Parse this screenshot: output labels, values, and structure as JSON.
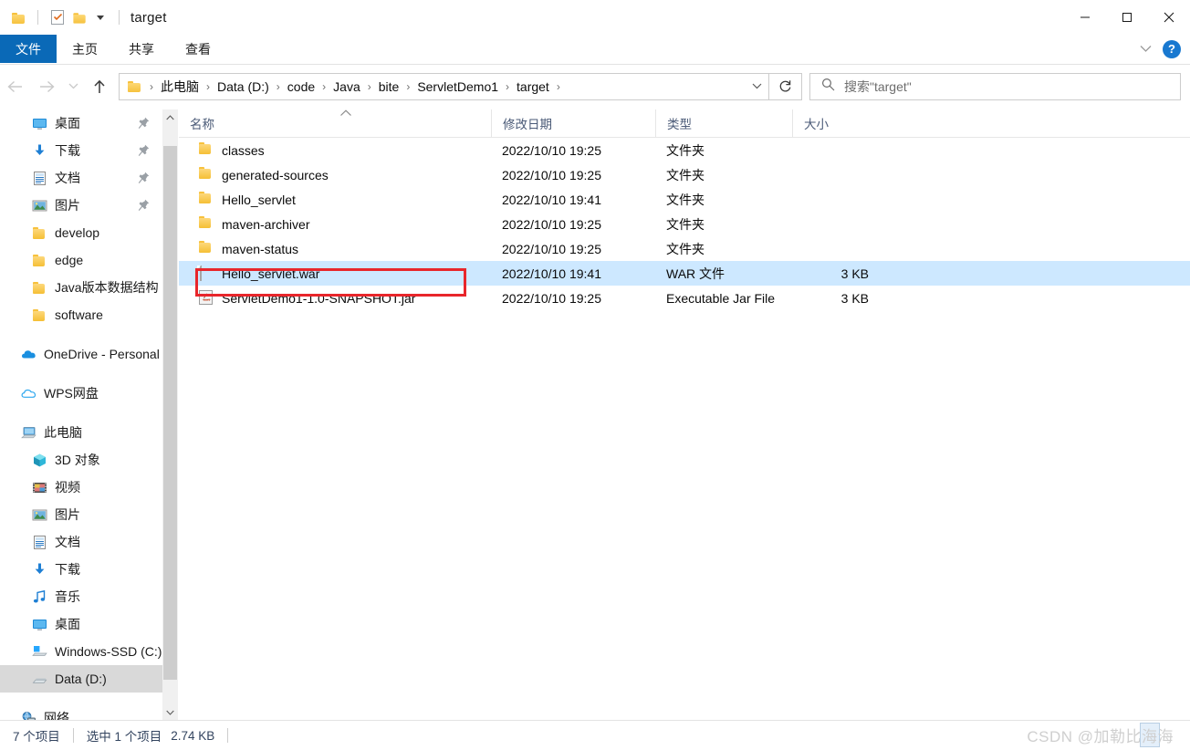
{
  "window": {
    "title": "target",
    "quick_access": [
      {
        "name": "folder-icon",
        "label": "folder"
      },
      {
        "name": "properties-icon",
        "label": "properties"
      },
      {
        "name": "new-folder-icon",
        "label": "new folder"
      },
      {
        "name": "customize-caret-icon",
        "label": "customize quick access toolbar"
      }
    ],
    "controls": {
      "minimize": "minimize",
      "maximize": "maximize",
      "close": "close"
    }
  },
  "ribbon": {
    "tabs": [
      {
        "label": "文件",
        "active": true
      },
      {
        "label": "主页",
        "active": false
      },
      {
        "label": "共享",
        "active": false
      },
      {
        "label": "查看",
        "active": false
      }
    ],
    "collapse_icon": "chevron-down-icon",
    "help_label": "?"
  },
  "nav": {
    "back": "back-arrow-icon",
    "forward": "forward-arrow-icon",
    "recent": "chevron-down-icon",
    "up": "up-arrow-icon",
    "breadcrumbs": [
      "此电脑",
      "Data (D:)",
      "code",
      "Java",
      "bite",
      "ServletDemo1",
      "target"
    ],
    "separator": "›",
    "dropdown_icon": "chevron-down-icon",
    "refresh_icon": "refresh-icon"
  },
  "search": {
    "icon": "search-icon",
    "placeholder": "搜索\"target\""
  },
  "sidebar": {
    "scroll_up_icon": "chevron-up-icon",
    "scroll_down_icon": "chevron-down-icon",
    "groups": [
      {
        "items": [
          {
            "label": "桌面",
            "icon": "desktop-icon",
            "pinned": true,
            "indent": 1
          },
          {
            "label": "下载",
            "icon": "downloads-icon",
            "pinned": true,
            "indent": 1
          },
          {
            "label": "文档",
            "icon": "documents-icon",
            "pinned": true,
            "indent": 1
          },
          {
            "label": "图片",
            "icon": "pictures-icon",
            "pinned": true,
            "indent": 1
          },
          {
            "label": "develop",
            "icon": "folder-icon",
            "pinned": false,
            "indent": 1
          },
          {
            "label": "edge",
            "icon": "folder-icon",
            "pinned": false,
            "indent": 1
          },
          {
            "label": "Java版本数据结构",
            "icon": "folder-icon",
            "pinned": false,
            "indent": 1
          },
          {
            "label": "software",
            "icon": "folder-icon",
            "pinned": false,
            "indent": 1
          }
        ]
      },
      {
        "items": [
          {
            "label": "OneDrive - Personal",
            "icon": "onedrive-icon",
            "pinned": false,
            "indent": 0
          }
        ]
      },
      {
        "items": [
          {
            "label": "WPS网盘",
            "icon": "wps-cloud-icon",
            "pinned": false,
            "indent": 0
          }
        ]
      },
      {
        "items": [
          {
            "label": "此电脑",
            "icon": "this-pc-icon",
            "pinned": false,
            "indent": 0
          },
          {
            "label": "3D 对象",
            "icon": "3d-objects-icon",
            "pinned": false,
            "indent": 1
          },
          {
            "label": "视频",
            "icon": "videos-icon",
            "pinned": false,
            "indent": 1
          },
          {
            "label": "图片",
            "icon": "pictures-icon",
            "pinned": false,
            "indent": 1
          },
          {
            "label": "文档",
            "icon": "documents-icon",
            "pinned": false,
            "indent": 1
          },
          {
            "label": "下载",
            "icon": "downloads-icon",
            "pinned": false,
            "indent": 1
          },
          {
            "label": "音乐",
            "icon": "music-icon",
            "pinned": false,
            "indent": 1
          },
          {
            "label": "桌面",
            "icon": "desktop-icon",
            "pinned": false,
            "indent": 1
          },
          {
            "label": "Windows-SSD (C:)",
            "icon": "windows-drive-icon",
            "pinned": false,
            "indent": 1
          },
          {
            "label": "Data (D:)",
            "icon": "drive-icon",
            "pinned": false,
            "indent": 1,
            "selected": true
          }
        ]
      },
      {
        "items": [
          {
            "label": "网络",
            "icon": "network-icon",
            "pinned": false,
            "indent": 0
          }
        ]
      }
    ]
  },
  "filelist": {
    "columns": [
      {
        "key": "name",
        "label": "名称",
        "sorted": "asc"
      },
      {
        "key": "date",
        "label": "修改日期"
      },
      {
        "key": "type",
        "label": "类型"
      },
      {
        "key": "size",
        "label": "大小"
      }
    ],
    "rows": [
      {
        "name": "classes",
        "date": "2022/10/10 19:25",
        "type": "文件夹",
        "size": "",
        "icon": "folder-icon",
        "selected": false
      },
      {
        "name": "generated-sources",
        "date": "2022/10/10 19:25",
        "type": "文件夹",
        "size": "",
        "icon": "folder-icon",
        "selected": false
      },
      {
        "name": "Hello_servlet",
        "date": "2022/10/10 19:41",
        "type": "文件夹",
        "size": "",
        "icon": "folder-icon",
        "selected": false
      },
      {
        "name": "maven-archiver",
        "date": "2022/10/10 19:25",
        "type": "文件夹",
        "size": "",
        "icon": "folder-icon",
        "selected": false
      },
      {
        "name": "maven-status",
        "date": "2022/10/10 19:25",
        "type": "文件夹",
        "size": "",
        "icon": "folder-icon",
        "selected": false
      },
      {
        "name": "Hello_servlet.war",
        "date": "2022/10/10 19:41",
        "type": "WAR 文件",
        "size": "3 KB",
        "icon": "generic-file-icon",
        "selected": true,
        "highlighted": true
      },
      {
        "name": "ServletDemo1-1.0-SNAPSHOT.jar",
        "date": "2022/10/10 19:25",
        "type": "Executable Jar File",
        "size": "3 KB",
        "icon": "java-jar-icon",
        "selected": false
      }
    ]
  },
  "status": {
    "item_count": "7 个项目",
    "selection": "选中 1 个项目",
    "selection_size": "2.74 KB"
  },
  "watermark": {
    "prefix": "CSDN @加勒比",
    "boxed": "海",
    "suffix": "海"
  },
  "colors": {
    "accent": "#0a69b7",
    "selection": "#cde8ff",
    "annotation": "#e8262b",
    "folder": "#f5bf35"
  }
}
